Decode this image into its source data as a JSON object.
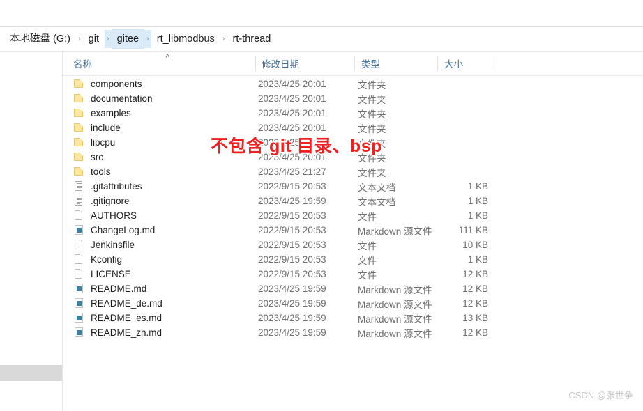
{
  "window": {
    "top_strip_blank": ""
  },
  "breadcrumb": {
    "name": "address-bar",
    "separator": "›",
    "items": [
      {
        "label": "本地磁盘 (G:)",
        "highlighted": false
      },
      {
        "label": "git",
        "highlighted": false
      },
      {
        "label": "gitee",
        "highlighted": true
      },
      {
        "label": "rt_libmodbus",
        "highlighted": false
      },
      {
        "label": "rt-thread",
        "highlighted": false
      }
    ]
  },
  "columns": {
    "sort_indicator": "˄",
    "headers": [
      {
        "label": "名称",
        "key": "name"
      },
      {
        "label": "修改日期",
        "key": "date"
      },
      {
        "label": "类型",
        "key": "type"
      },
      {
        "label": "大小",
        "key": "size"
      }
    ]
  },
  "files": [
    {
      "icon": "folder-icon",
      "name": "components",
      "date": "2023/4/25 20:01",
      "type": "文件夹",
      "size": ""
    },
    {
      "icon": "folder-icon",
      "name": "documentation",
      "date": "2023/4/25 20:01",
      "type": "文件夹",
      "size": ""
    },
    {
      "icon": "folder-icon",
      "name": "examples",
      "date": "2023/4/25 20:01",
      "type": "文件夹",
      "size": ""
    },
    {
      "icon": "folder-icon",
      "name": "include",
      "date": "2023/4/25 20:01",
      "type": "文件夹",
      "size": ""
    },
    {
      "icon": "folder-icon",
      "name": "libcpu",
      "date": "2023/4/25 20:01",
      "type": "文件夹",
      "size": ""
    },
    {
      "icon": "folder-icon",
      "name": "src",
      "date": "2023/4/25 20:01",
      "type": "文件夹",
      "size": ""
    },
    {
      "icon": "folder-icon",
      "name": "tools",
      "date": "2023/4/25 21:27",
      "type": "文件夹",
      "size": ""
    },
    {
      "icon": "text-document-icon",
      "name": ".gitattributes",
      "date": "2022/9/15 20:53",
      "type": "文本文档",
      "size": "1 KB"
    },
    {
      "icon": "text-document-icon",
      "name": ".gitignore",
      "date": "2023/4/25 19:59",
      "type": "文本文档",
      "size": "1 KB"
    },
    {
      "icon": "file-icon",
      "name": "AUTHORS",
      "date": "2022/9/15 20:53",
      "type": "文件",
      "size": "1 KB"
    },
    {
      "icon": "markdown-icon",
      "name": "ChangeLog.md",
      "date": "2022/9/15 20:53",
      "type": "Markdown 源文件",
      "size": "111 KB"
    },
    {
      "icon": "file-icon",
      "name": "Jenkinsfile",
      "date": "2022/9/15 20:53",
      "type": "文件",
      "size": "10 KB"
    },
    {
      "icon": "file-icon",
      "name": "Kconfig",
      "date": "2022/9/15 20:53",
      "type": "文件",
      "size": "1 KB"
    },
    {
      "icon": "file-icon",
      "name": "LICENSE",
      "date": "2022/9/15 20:53",
      "type": "文件",
      "size": "12 KB"
    },
    {
      "icon": "markdown-icon",
      "name": "README.md",
      "date": "2023/4/25 19:59",
      "type": "Markdown 源文件",
      "size": "12 KB"
    },
    {
      "icon": "markdown-icon",
      "name": "README_de.md",
      "date": "2023/4/25 19:59",
      "type": "Markdown 源文件",
      "size": "12 KB"
    },
    {
      "icon": "markdown-icon",
      "name": "README_es.md",
      "date": "2023/4/25 19:59",
      "type": "Markdown 源文件",
      "size": "13 KB"
    },
    {
      "icon": "markdown-icon",
      "name": "README_zh.md",
      "date": "2023/4/25 19:59",
      "type": "Markdown 源文件",
      "size": "12 KB"
    }
  ],
  "annotation": {
    "text": "不包含 git 目录、bsp",
    "color": "#ef2020"
  },
  "watermark": {
    "text": "CSDN @张世争"
  }
}
